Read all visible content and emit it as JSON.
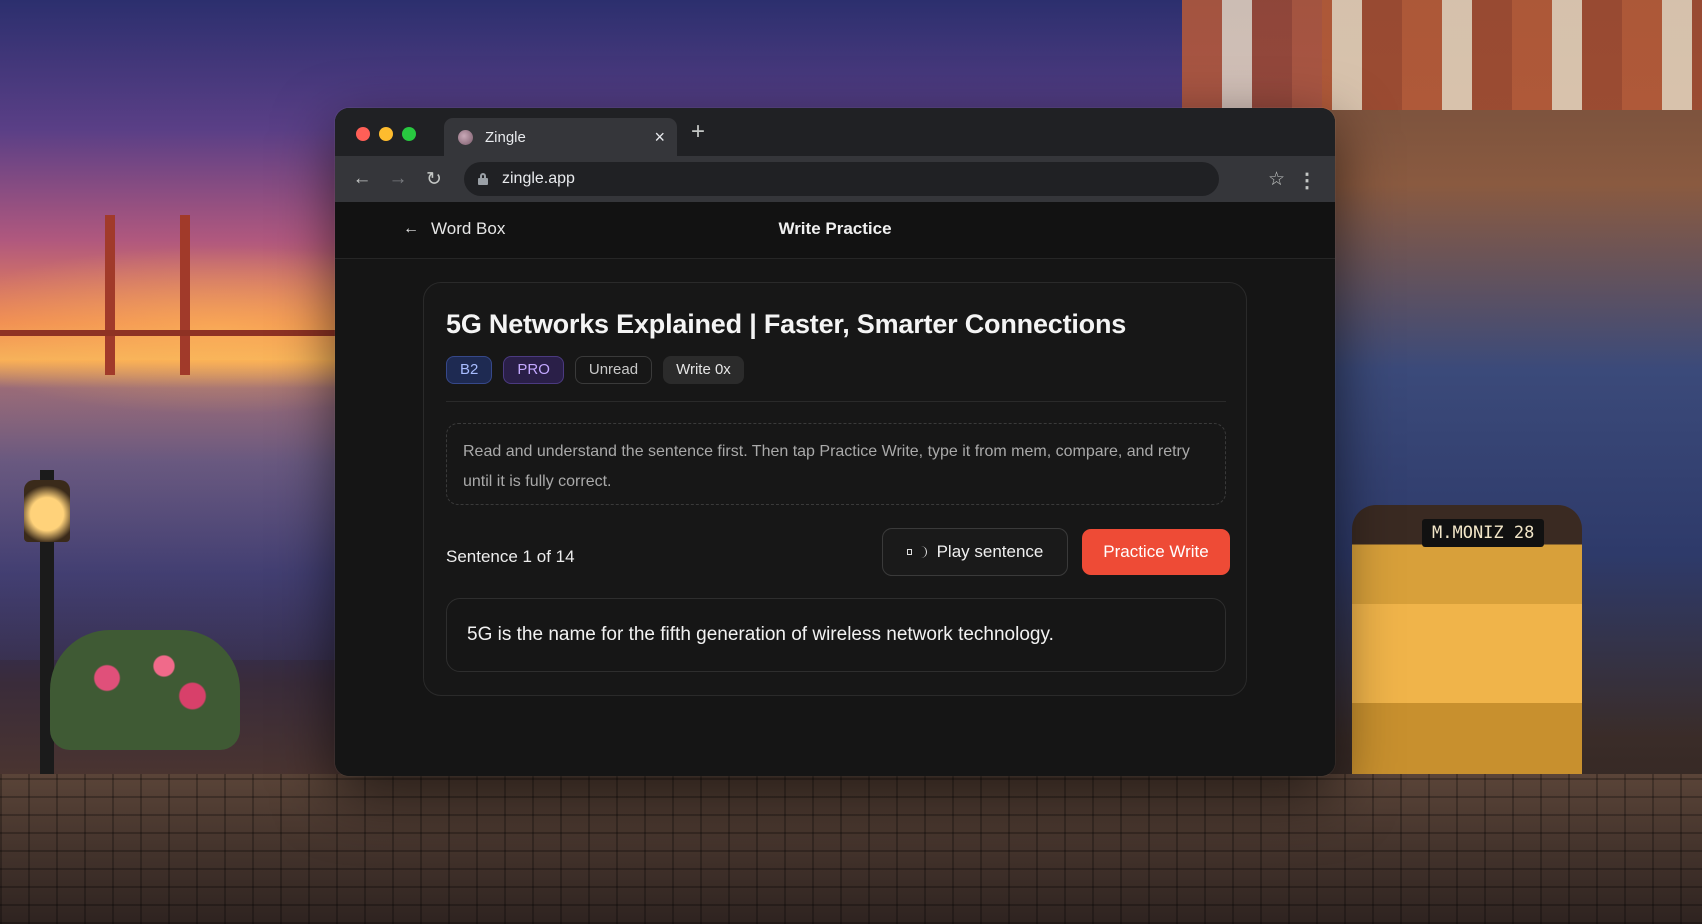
{
  "browser": {
    "tab_title": "Zingle",
    "tab_close": "×",
    "new_tab": "+",
    "url": "zingle.app"
  },
  "header": {
    "back_label": "Word Box",
    "title": "Write Practice"
  },
  "lesson": {
    "title": "5G Networks Explained | Faster, Smarter Connections",
    "tags": {
      "level": "B2",
      "plan": "PRO",
      "status": "Unread",
      "write_count": "Write 0x"
    },
    "instructions": "Read and understand the sentence first. Then tap Practice Write, type it from mem, compare, and retry until it is fully correct.",
    "counter": "Sentence 1 of 14",
    "play_label": "Play sentence",
    "practice_label": "Practice Write",
    "sentence": "5G is the name for the fifth generation of wireless network technology."
  },
  "scene": {
    "tram_sign": "M.MONIZ 28"
  },
  "colors": {
    "accent": "#ee4b36",
    "level_tag": "#a8bcff",
    "pro_tag": "#c3a8ff"
  },
  "icons": {
    "back": "arrow-left-icon",
    "forward": "arrow-right-icon",
    "reload": "reload-icon",
    "lock": "lock-icon",
    "bookmark": "star-icon",
    "menu": "kebab-menu-icon",
    "speaker": "speaker-icon"
  }
}
